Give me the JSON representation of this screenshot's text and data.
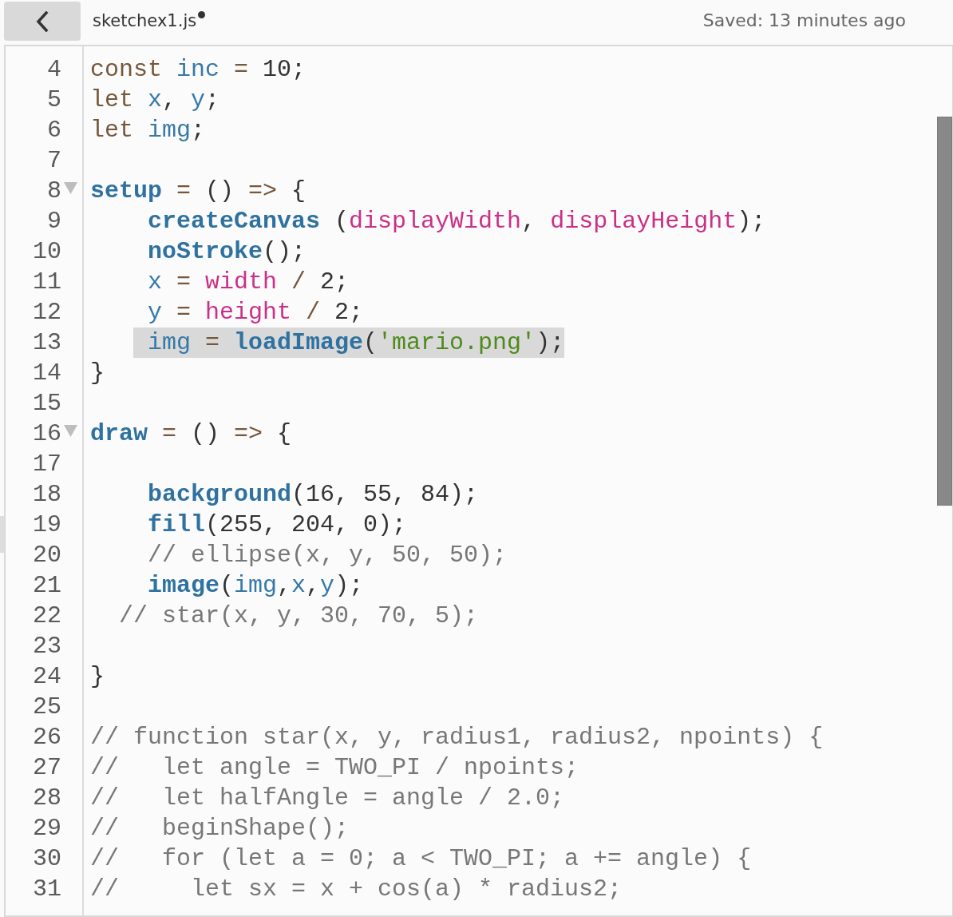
{
  "file": {
    "name": "sketchex1.js",
    "unsaved": true
  },
  "save_status": "Saved: 13 minutes ago",
  "editor": {
    "lines": [
      {
        "number": "4",
        "selected": false,
        "tokens": [
          {
            "text": "const",
            "kind": "keyword"
          },
          {
            "text": " inc",
            "kind": "variable"
          },
          {
            "text": " =",
            "kind": "keyword"
          },
          {
            "text": " 10;",
            "kind": "plain"
          }
        ]
      },
      {
        "number": "5",
        "selected": false,
        "tokens": [
          {
            "text": "let",
            "kind": "keyword"
          },
          {
            "text": " x",
            "kind": "variable"
          },
          {
            "text": ",",
            "kind": "plain"
          },
          {
            "text": " y",
            "kind": "variable"
          },
          {
            "text": ";",
            "kind": "plain"
          }
        ]
      },
      {
        "number": "6",
        "selected": false,
        "tokens": [
          {
            "text": "let",
            "kind": "keyword"
          },
          {
            "text": " img",
            "kind": "variable"
          },
          {
            "text": ";",
            "kind": "plain"
          }
        ]
      },
      {
        "number": "7",
        "selected": false
      },
      {
        "number": "8",
        "selected": false,
        "expanded": true,
        "tokens": [
          {
            "text": "setup",
            "kind": "function"
          },
          {
            "text": " =",
            "kind": "keyword"
          },
          {
            "text": " ()",
            "kind": "plain"
          },
          {
            "text": " =>",
            "kind": "keyword"
          },
          {
            "text": " {",
            "kind": "plain"
          }
        ]
      },
      {
        "number": "9",
        "selected": false,
        "tokens": [
          {
            "text": "    createCanvas",
            "kind": "function"
          },
          {
            "text": " (",
            "kind": "plain"
          },
          {
            "text": "displayWidth",
            "kind": "builtin"
          },
          {
            "text": ",",
            "kind": "plain"
          },
          {
            "text": " displayHeight",
            "kind": "builtin"
          },
          {
            "text": ");",
            "kind": "plain"
          }
        ]
      },
      {
        "number": "10",
        "selected": false,
        "tokens": [
          {
            "text": "    noStroke",
            "kind": "function"
          },
          {
            "text": "();",
            "kind": "plain"
          }
        ]
      },
      {
        "number": "11",
        "selected": false,
        "tokens": [
          {
            "text": "    x",
            "kind": "variable"
          },
          {
            "text": " =",
            "kind": "keyword"
          },
          {
            "text": " width",
            "kind": "builtin"
          },
          {
            "text": " /",
            "kind": "keyword"
          },
          {
            "text": " 2;",
            "kind": "plain"
          }
        ]
      },
      {
        "number": "12",
        "selected": false,
        "tokens": [
          {
            "text": "    y",
            "kind": "variable"
          },
          {
            "text": " =",
            "kind": "keyword"
          },
          {
            "text": " height",
            "kind": "builtin"
          },
          {
            "text": " /",
            "kind": "keyword"
          },
          {
            "text": " 2;",
            "kind": "plain"
          }
        ]
      },
      {
        "number": "13",
        "selected": true,
        "tokens": [
          {
            "text": "    img",
            "kind": "variable"
          },
          {
            "text": " =",
            "kind": "keyword"
          },
          {
            "text": " loadImage",
            "kind": "function"
          },
          {
            "text": "(",
            "kind": "plain"
          },
          {
            "text": "'mario.png'",
            "kind": "string"
          },
          {
            "text": ");",
            "kind": "plain"
          }
        ]
      },
      {
        "number": "14",
        "selected": false,
        "tokens": [
          {
            "text": "}",
            "kind": "plain"
          }
        ]
      },
      {
        "number": "15",
        "selected": false
      },
      {
        "number": "16",
        "selected": false,
        "expanded": true,
        "tokens": [
          {
            "text": "draw",
            "kind": "function"
          },
          {
            "text": " =",
            "kind": "keyword"
          },
          {
            "text": " ()",
            "kind": "plain"
          },
          {
            "text": " =>",
            "kind": "keyword"
          },
          {
            "text": " {",
            "kind": "plain"
          }
        ]
      },
      {
        "number": "17",
        "selected": false
      },
      {
        "number": "18",
        "selected": false,
        "tokens": [
          {
            "text": "    background",
            "kind": "function"
          },
          {
            "text": "(16, 55, 84);",
            "kind": "plain"
          }
        ]
      },
      {
        "number": "19",
        "selected": false,
        "tokens": [
          {
            "text": "    fill",
            "kind": "function"
          },
          {
            "text": "(255, 204, 0);",
            "kind": "plain"
          }
        ]
      },
      {
        "number": "20",
        "selected": false,
        "tokens": [
          {
            "text": "    // ellipse(x, y, 50, 50);",
            "kind": "comment"
          }
        ]
      },
      {
        "number": "21",
        "selected": false,
        "tokens": [
          {
            "text": "    image",
            "kind": "function"
          },
          {
            "text": "(",
            "kind": "plain"
          },
          {
            "text": "img",
            "kind": "variable"
          },
          {
            "text": ",",
            "kind": "plain"
          },
          {
            "text": "x",
            "kind": "variable"
          },
          {
            "text": ",",
            "kind": "plain"
          },
          {
            "text": "y",
            "kind": "variable"
          },
          {
            "text": ");",
            "kind": "plain"
          }
        ]
      },
      {
        "number": "22",
        "selected": false,
        "tokens": [
          {
            "text": "  // star(x, y, 30, 70, 5);",
            "kind": "comment"
          }
        ]
      },
      {
        "number": "23",
        "selected": false
      },
      {
        "number": "24",
        "selected": false,
        "tokens": [
          {
            "text": "}",
            "kind": "plain"
          }
        ]
      },
      {
        "number": "25",
        "selected": false
      },
      {
        "number": "26",
        "selected": false,
        "tokens": [
          {
            "text": "// function star(x, y, radius1, radius2, npoints) {",
            "kind": "comment"
          }
        ]
      },
      {
        "number": "27",
        "selected": false,
        "tokens": [
          {
            "text": "//   let angle = TWO_PI / npoints;",
            "kind": "comment"
          }
        ]
      },
      {
        "number": "28",
        "selected": false,
        "tokens": [
          {
            "text": "//   let halfAngle = angle / 2.0;",
            "kind": "comment"
          }
        ]
      },
      {
        "number": "29",
        "selected": false,
        "tokens": [
          {
            "text": "//   beginShape();",
            "kind": "comment"
          }
        ]
      },
      {
        "number": "30",
        "selected": false,
        "tokens": [
          {
            "text": "//   for (let a = 0; a < TWO_PI; a += angle) {",
            "kind": "comment"
          }
        ]
      },
      {
        "number": "31",
        "selected": false,
        "tokens": [
          {
            "text": "//     let sx = x + cos(a) * radius2;",
            "kind": "comment"
          }
        ]
      }
    ]
  }
}
